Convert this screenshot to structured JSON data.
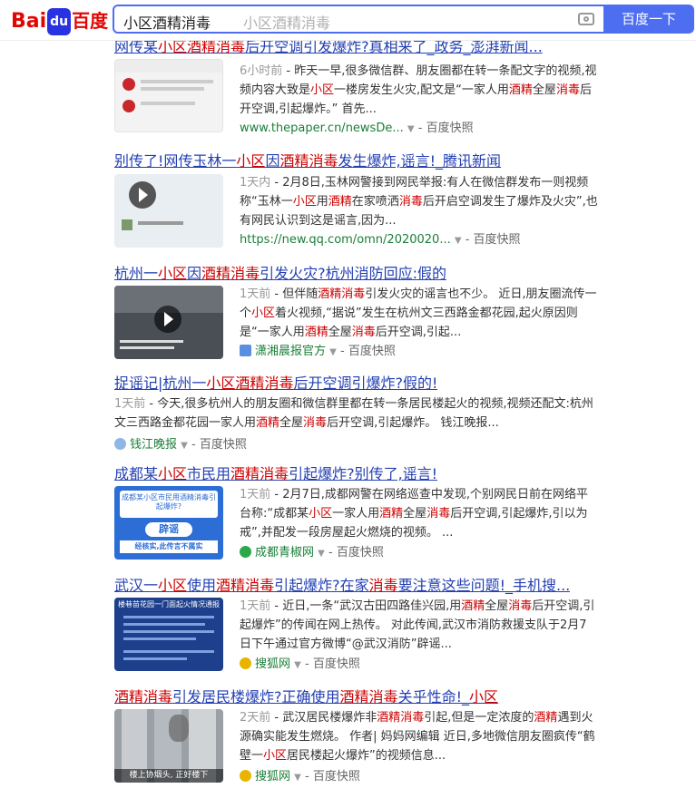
{
  "header": {
    "logo_bai": "Bai",
    "logo_du": "du",
    "logo_cn": "百度",
    "query": "小区酒精消毒",
    "placeholder": "小区酒精消毒",
    "search_button": "百度一下"
  },
  "top_cut_title": "网传某小区酒精消毒后开空调引发爆炸?真相来了_政务_澎湃新闻...",
  "results": [
    {
      "time": "6小时前",
      "body": " - 昨天一早,很多微信群、朋友圈都在转一条配文字的视频,视频内容大致是小区一楼房发生火灾,配文是“一家人用酒精全屋消毒后开空调,引起爆炸。” 首先...",
      "source": "www.thepaper.cn/newsDe...",
      "snapshot": "百度快照"
    },
    {
      "title": "别传了!网传玉林一小区因酒精消毒发生爆炸,谣言!_腾讯新闻",
      "time": "1天内",
      "body": " - 2月8日,玉林网警接到网民举报:有人在微信群发布一则视频称“玉林一小区用酒精在家喷洒消毒后开启空调发生了爆炸及火灾”,也有网民认识到这是谣言,因为...",
      "source": "https://new.qq.com/omn/2020020...",
      "snapshot": "百度快照"
    },
    {
      "title": "杭州一小区因酒精消毒引发火灾?杭州消防回应:假的",
      "time": "1天前",
      "body": " - 但伴随酒精消毒引发火灾的谣言也不少。 近日,朋友圈流传一个小区着火视频,“据说”发生在杭州文三西路金都花园,起火原因则是“一家人用酒精全屋消毒后开空调,引起...",
      "source": "潇湘晨报官方",
      "snapshot": "百度快照"
    },
    {
      "title": "捉谣记|杭州一小区酒精消毒后开空调引爆炸?假的!",
      "time": "1天前",
      "body": " - 今天,很多杭州人的朋友圈和微信群里都在转一条居民楼起火的视频,视频还配文:杭州文三西路金都花园一家人用酒精全屋消毒后开空调,引起爆炸。 钱江晚报...",
      "source": "钱江晚报",
      "snapshot": "百度快照"
    },
    {
      "title": "成都某小区市民用酒精消毒引起爆炸?别传了,谣言!",
      "time": "1天前",
      "body": " - 2月7日,成都网警在网络巡查中发现,个别网民日前在网络平台称:“成都某小区一家人用酒精全屋消毒后开空调,引起爆炸,引以为戒”,并配发一段房屋起火燃烧的视频。 ...",
      "source": "成都青椒网",
      "snapshot": "百度快照",
      "thumb_text": "成都某小区市民用酒精消毒引起爆炸?",
      "thumb_text2": "辟谣",
      "thumb_text3": "经核实,此传言不属实"
    },
    {
      "title": "武汉一小区使用酒精消毒引起爆炸?在家消毒要注意这些问题!_手机搜...",
      "time": "1天前",
      "body": " - 近日,一条“武汉古田四路佳兴园,用酒精全屋消毒后开空调,引起爆炸”的传闻在网上热传。 对此传闻,武汉市消防救援支队于2月7日下午通过官方微博“@武汉消防”辟谣...",
      "source": "搜狐网",
      "snapshot": "百度快照",
      "thumb_text": "楼巷苗花园一门面起火情况通报"
    },
    {
      "title": "酒精消毒引发居民楼爆炸?正确使用酒精消毒关乎性命!_小区",
      "time": "2天前",
      "body": " - 武汉居民楼爆炸非酒精消毒引起,但是一定浓度的酒精遇到火源确实能发生燃烧。 作者| 妈妈网编辑 近日,多地微信朋友圈疯传“鹤壁一小区居民楼起火爆炸”的视频信息...",
      "source": "搜狐网",
      "snapshot": "百度快照",
      "thumb_text": "楼上协烟头, 正好楼下"
    }
  ],
  "colors": {
    "accent": "#4e6ef2",
    "title": "#2440b3",
    "highlight": "#cc0000",
    "url": "#1a7f37"
  }
}
